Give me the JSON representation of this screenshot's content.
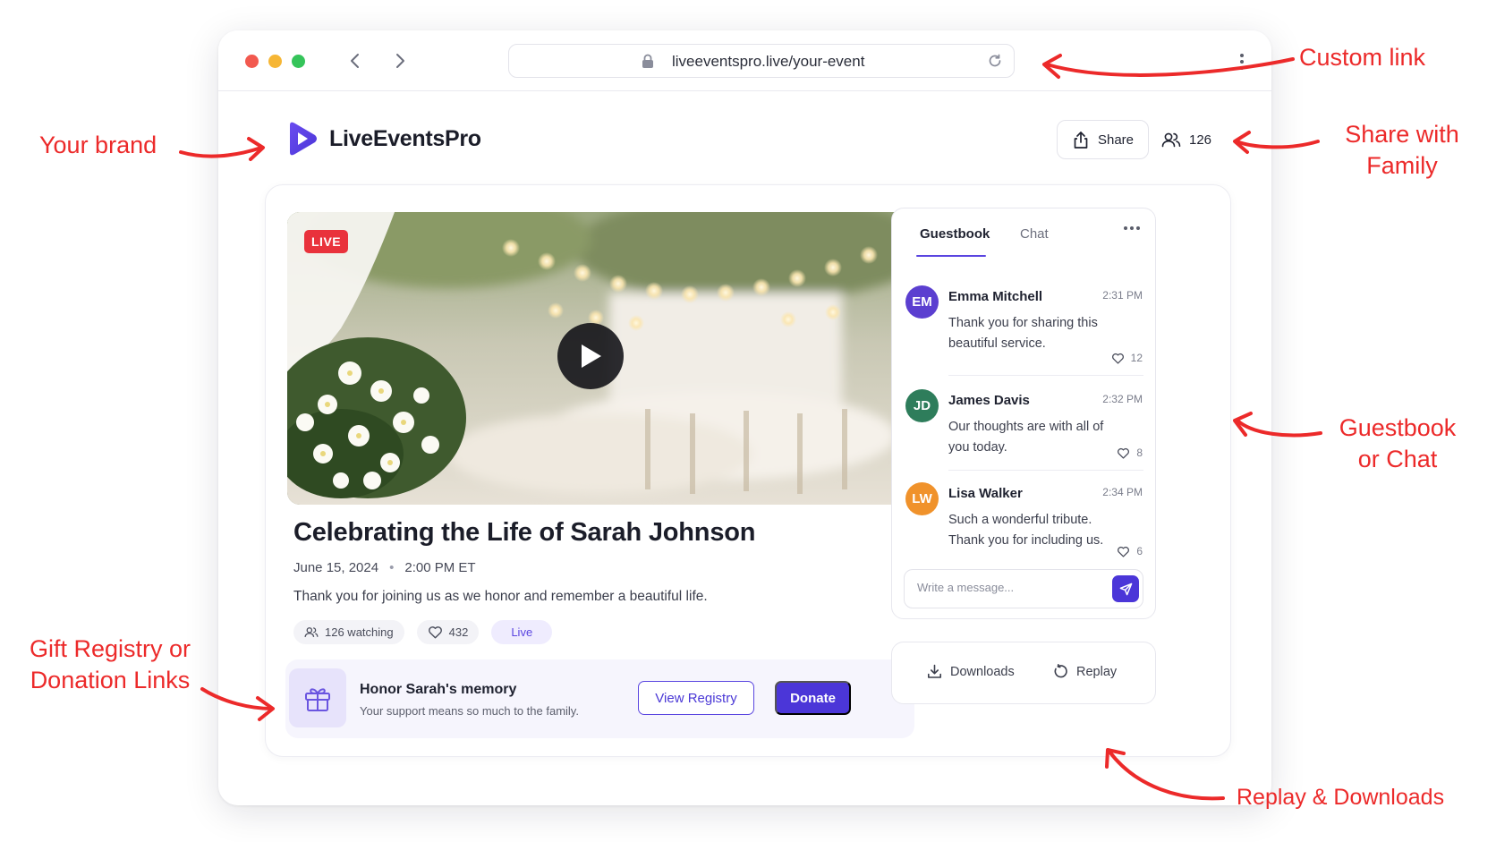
{
  "browser": {
    "url": "liveeventspro.live/your-event"
  },
  "header": {
    "brand_name": "LiveEventsPro",
    "share_label": "Share",
    "viewer_count": "126"
  },
  "video": {
    "live_badge": "LIVE"
  },
  "event": {
    "title": "Celebrating the Life of Sarah Johnson",
    "date": "June 15, 2024",
    "separator": "•",
    "time": "2:00 PM ET",
    "description": "Thank you for joining us as we honor and remember a beautiful life.",
    "watching": "126 watching",
    "likes": "432",
    "status": "Live"
  },
  "registry": {
    "title": "Honor Sarah's memory",
    "subtitle": "Your support means so much to the family.",
    "view_registry_label": "View Registry",
    "donate_label": "Donate"
  },
  "panel": {
    "tabs": [
      {
        "label": "Guestbook",
        "active": true
      },
      {
        "label": "Chat",
        "active": false
      }
    ],
    "messages": [
      {
        "initials": "EM",
        "name": "Emma Mitchell",
        "time": "2:31 PM",
        "text": "Thank you for sharing this beautiful service.",
        "likes": "12",
        "color": "#5b3fd0"
      },
      {
        "initials": "JD",
        "name": "James Davis",
        "time": "2:32 PM",
        "text": "Our thoughts are with all of you today.",
        "likes": "8",
        "color": "#2e7d5b"
      },
      {
        "initials": "LW",
        "name": "Lisa Walker",
        "time": "2:34 PM",
        "text": "Such a wonderful tribute. Thank you for including us.",
        "likes": "6",
        "color": "#f0922b"
      }
    ],
    "input_placeholder": "Write a message..."
  },
  "media_actions": {
    "downloads_label": "Downloads",
    "replay_label": "Replay"
  },
  "annotations": {
    "custom_link": "Custom link",
    "your_brand": "Your brand",
    "share_family_1": "Share with",
    "share_family_2": "Family",
    "guestbook_chat_1": "Guestbook",
    "guestbook_chat_2": "or Chat",
    "gift_registry_1": "Gift Registry or",
    "gift_registry_2": "Donation Links",
    "replay_downloads": "Replay & Downloads"
  },
  "colors": {
    "accent": "#4b36d8",
    "annotation": "#ec2a2a",
    "live_red": "#e9323c"
  }
}
